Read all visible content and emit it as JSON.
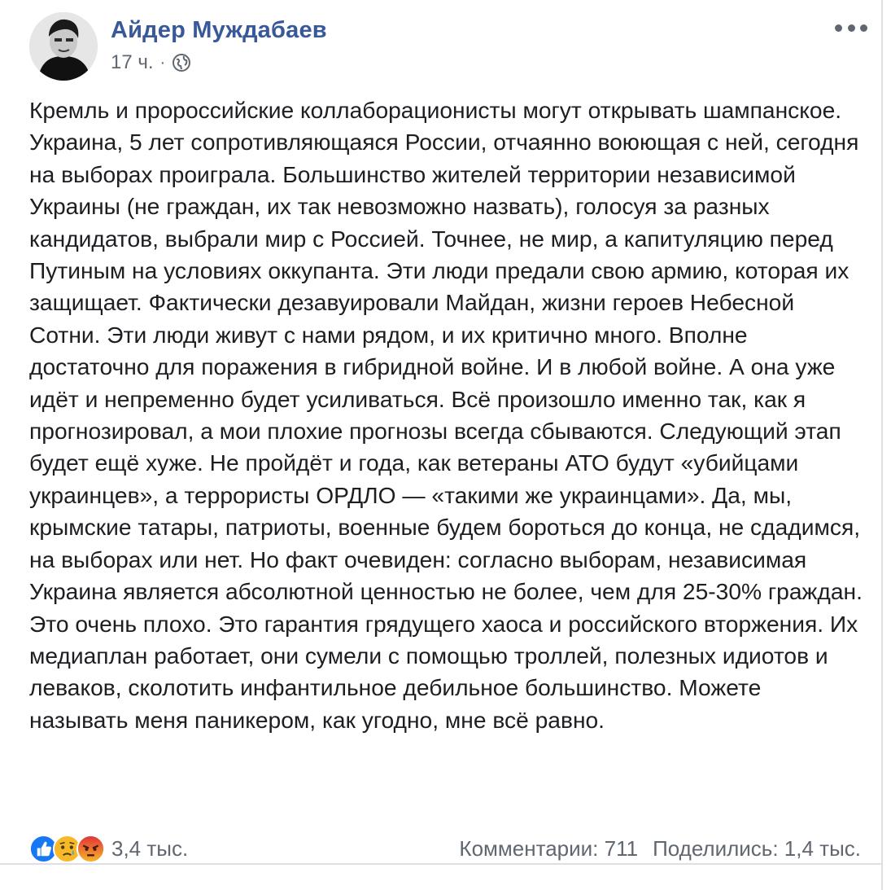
{
  "post": {
    "author": "Айдер Муждабаев",
    "timestamp": "17 ч.",
    "separator": "·",
    "privacy_icon": "globe-icon",
    "more_icon": "more-options-icon",
    "text": "Кремль и пророссийские коллаборационисты могут открывать шампанское. Украина, 5 лет сопротивляющаяся России, отчаянно воюющая с ней, сегодня на выборах проиграла. Большинство жителей территории независимой Украины (не граждан, их так невозможно назвать), голосуя за разных кандидатов, выбрали мир с Россией. Точнее, не мир, а капитуляцию перед Путиным на условиях оккупанта. Эти люди предали свою армию, которая их защищает. Фактически дезавуировали Майдан, жизни героев Небесной Сотни. Эти люди живут с нами рядом, и их критично много. Вполне достаточно для поражения в гибридной войне. И в любой войне. А она уже идёт и непременно будет усиливаться. Всё произошло именно так, как я прогнозировал, а мои плохие прогнозы всегда сбываются. Следующий этап будет ещё хуже. Не пройдёт и года, как ветераны АТО будут «убийцами украинцев», а террористы ОРДЛО — «такими же украинцами». Да, мы, крымские татары, патриоты, военные будем бороться до конца, не сдадимся, на выборах или нет. Но факт очевиден: согласно выборам, независимая Украина является абсолютной ценностью не более, чем для 25-30% граждан. Это очень плохо. Это гарантия грядущего хаоса и российского вторжения. Их медиаплан работает, они сумели с помощью троллей, полезных идиотов и леваков, сколотить инфантильное дебильное большинство. Можете называть меня паникером, как угодно, мне всё равно."
  },
  "footer": {
    "reaction_icons": [
      "like-reaction-icon",
      "sad-reaction-icon",
      "angry-reaction-icon"
    ],
    "reaction_count": "3,4 тыс.",
    "comments": "Комментарии: 711",
    "shares": "Поделились: 1,4 тыс."
  },
  "colors": {
    "author_link": "#385898",
    "secondary_text": "#606770",
    "body_text": "#1c1e21",
    "like_blue": "#1877f2",
    "sad_yellow": "#f7b928",
    "angry_red": "#e9710f"
  }
}
